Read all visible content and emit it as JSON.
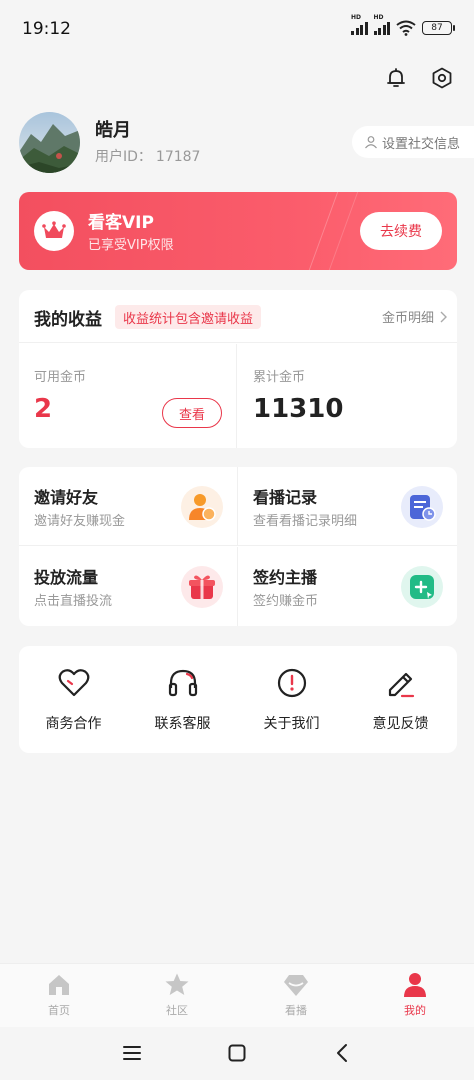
{
  "status_bar": {
    "time": "19:12",
    "battery": "87",
    "signal_label": "HD"
  },
  "colors": {
    "accent": "#e9374a",
    "vip_gradient_start": "#f34f5f",
    "vip_gradient_end": "#ff6c78"
  },
  "header_icons": [
    "bell-icon",
    "settings-icon"
  ],
  "profile": {
    "nickname": "皓月",
    "user_id_label": "用户ID：",
    "user_id": "17187",
    "social_button": "设置社交信息"
  },
  "vip": {
    "title": "看客VIP",
    "subtitle": "已享受VIP权限",
    "renew_button": "去续费"
  },
  "earnings": {
    "title": "我的收益",
    "tag": "收益统计包含邀请收益",
    "detail_link": "金币明细",
    "available_label": "可用金币",
    "available_value": "2",
    "view_button": "查看",
    "total_label": "累计金币",
    "total_value": "11310"
  },
  "features": [
    {
      "title": "邀请好友",
      "subtitle": "邀请好友赚现金",
      "icon": "invite-friend-icon"
    },
    {
      "title": "看播记录",
      "subtitle": "查看看播记录明细",
      "icon": "watch-history-icon"
    },
    {
      "title": "投放流量",
      "subtitle": "点击直播投流",
      "icon": "gift-icon"
    },
    {
      "title": "签约主播",
      "subtitle": "签约赚金币",
      "icon": "sign-streamer-icon"
    }
  ],
  "services": [
    {
      "label": "商务合作",
      "icon": "heart-icon"
    },
    {
      "label": "联系客服",
      "icon": "headset-icon"
    },
    {
      "label": "关于我们",
      "icon": "info-icon"
    },
    {
      "label": "意见反馈",
      "icon": "pencil-icon"
    }
  ],
  "tabs": [
    {
      "label": "首页",
      "icon": "home-icon",
      "active": false
    },
    {
      "label": "社区",
      "icon": "star-icon",
      "active": false
    },
    {
      "label": "看播",
      "icon": "diamond-icon",
      "active": false
    },
    {
      "label": "我的",
      "icon": "profile-icon",
      "active": true
    }
  ],
  "system_nav": [
    "menu-icon",
    "home-square-icon",
    "back-icon"
  ]
}
